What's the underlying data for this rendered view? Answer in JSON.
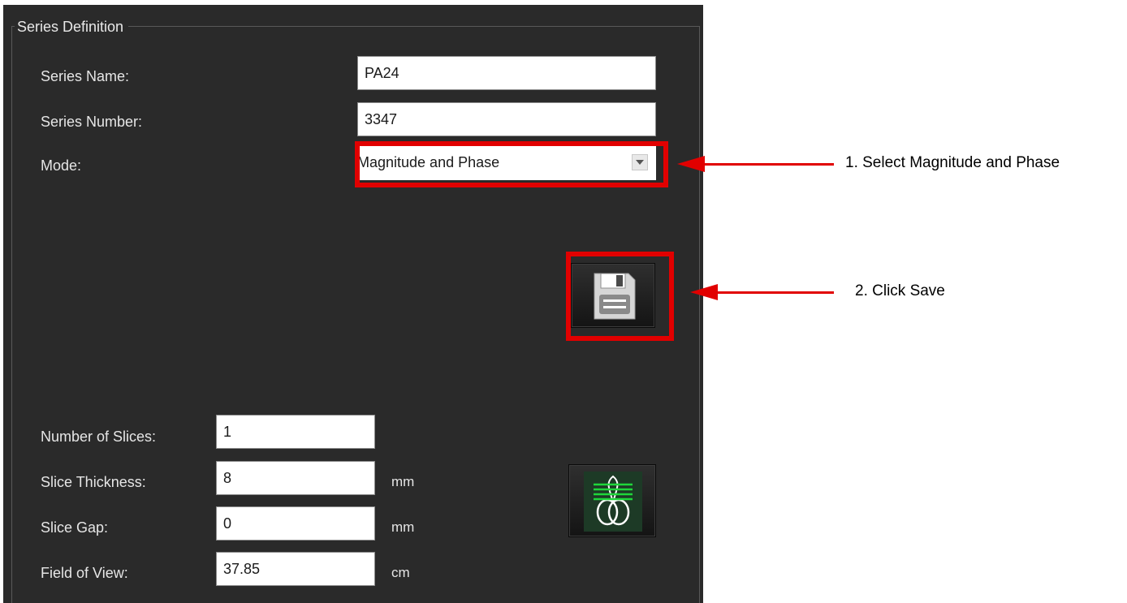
{
  "group": {
    "title": "Series Definition"
  },
  "fields": {
    "series_name": {
      "label": "Series Name:",
      "value": "PA24"
    },
    "series_number": {
      "label": "Series Number:",
      "value": "3347"
    },
    "mode": {
      "label": "Mode:",
      "value": "Magnitude and Phase"
    },
    "number_of_slices": {
      "label": "Number of Slices:",
      "value": "1"
    },
    "slice_thickness": {
      "label": "Slice Thickness:",
      "value": "8",
      "unit": "mm"
    },
    "slice_gap": {
      "label": "Slice Gap:",
      "value": "0",
      "unit": "mm"
    },
    "field_of_view": {
      "label": "Field of View:",
      "value": "37.85",
      "unit": "cm"
    }
  },
  "buttons": {
    "save_icon": "floppy-disk-icon",
    "slice_view_icon": "slice-planes-icon"
  },
  "annotations": {
    "step1": "1. Select Magnitude and Phase",
    "step2": "2. Click Save",
    "color": "#e10000"
  }
}
